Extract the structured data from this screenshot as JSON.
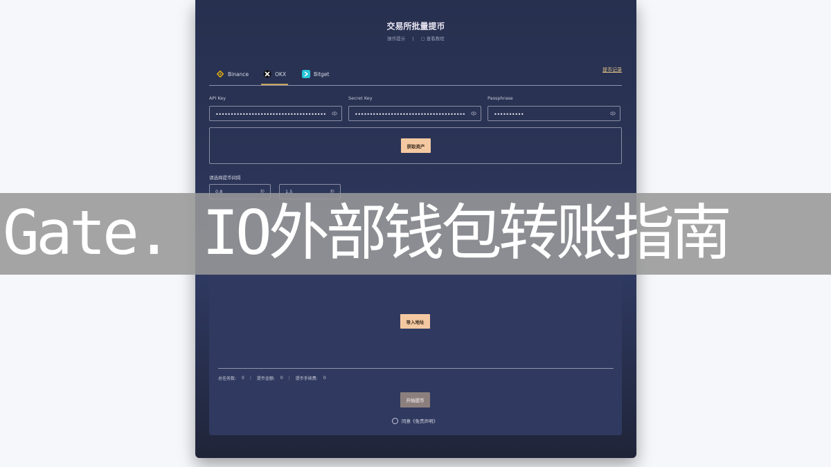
{
  "header": {
    "title": "交易所批量提币",
    "link_guide": "操作提示",
    "divider": "|",
    "link_tutorial": "查看教程"
  },
  "tabs": [
    {
      "label": "Binance",
      "icon": "binance-icon",
      "color": "#f0b90b"
    },
    {
      "label": "OKX",
      "icon": "okx-icon",
      "color": "#ffffff",
      "active": true
    },
    {
      "label": "Bitget",
      "icon": "bitget-icon",
      "color": "#27c4d8"
    }
  ],
  "record_link": "提币记录",
  "credentials": {
    "api_key": {
      "label": "API Key",
      "value": "••••••••••••••••••••••••••••••••••••••••"
    },
    "secret_key": {
      "label": "Secret Key",
      "value": "••••••••••••••••••••••••••••••••••••••"
    },
    "passphrase": {
      "label": "Passphrase",
      "value": "••••••••••"
    }
  },
  "get_assets_button": "获取资产",
  "interval": {
    "label": "请选择提币间隔",
    "min_value": "0.8",
    "min_unit": "秒",
    "max_value": "1.5",
    "max_unit": "秒"
  },
  "import_button": "导入地址",
  "stats": {
    "total_tasks_label": "总任务数:",
    "total_tasks_value": "0",
    "amount_label": "提币金额:",
    "amount_value": "0",
    "fee_label": "提币手续费:",
    "fee_value": "0"
  },
  "start_button": "开始提币",
  "agree_text": "同意《免责声明》",
  "banner_text": "Gate. IO外部钱包转账指南",
  "colors": {
    "panel": "#2b3456",
    "accent_button": "#f4c9a2",
    "disabled_button": "#8b7f7e",
    "active_tab_underline": "#c9a35a",
    "banner": "#989898"
  }
}
